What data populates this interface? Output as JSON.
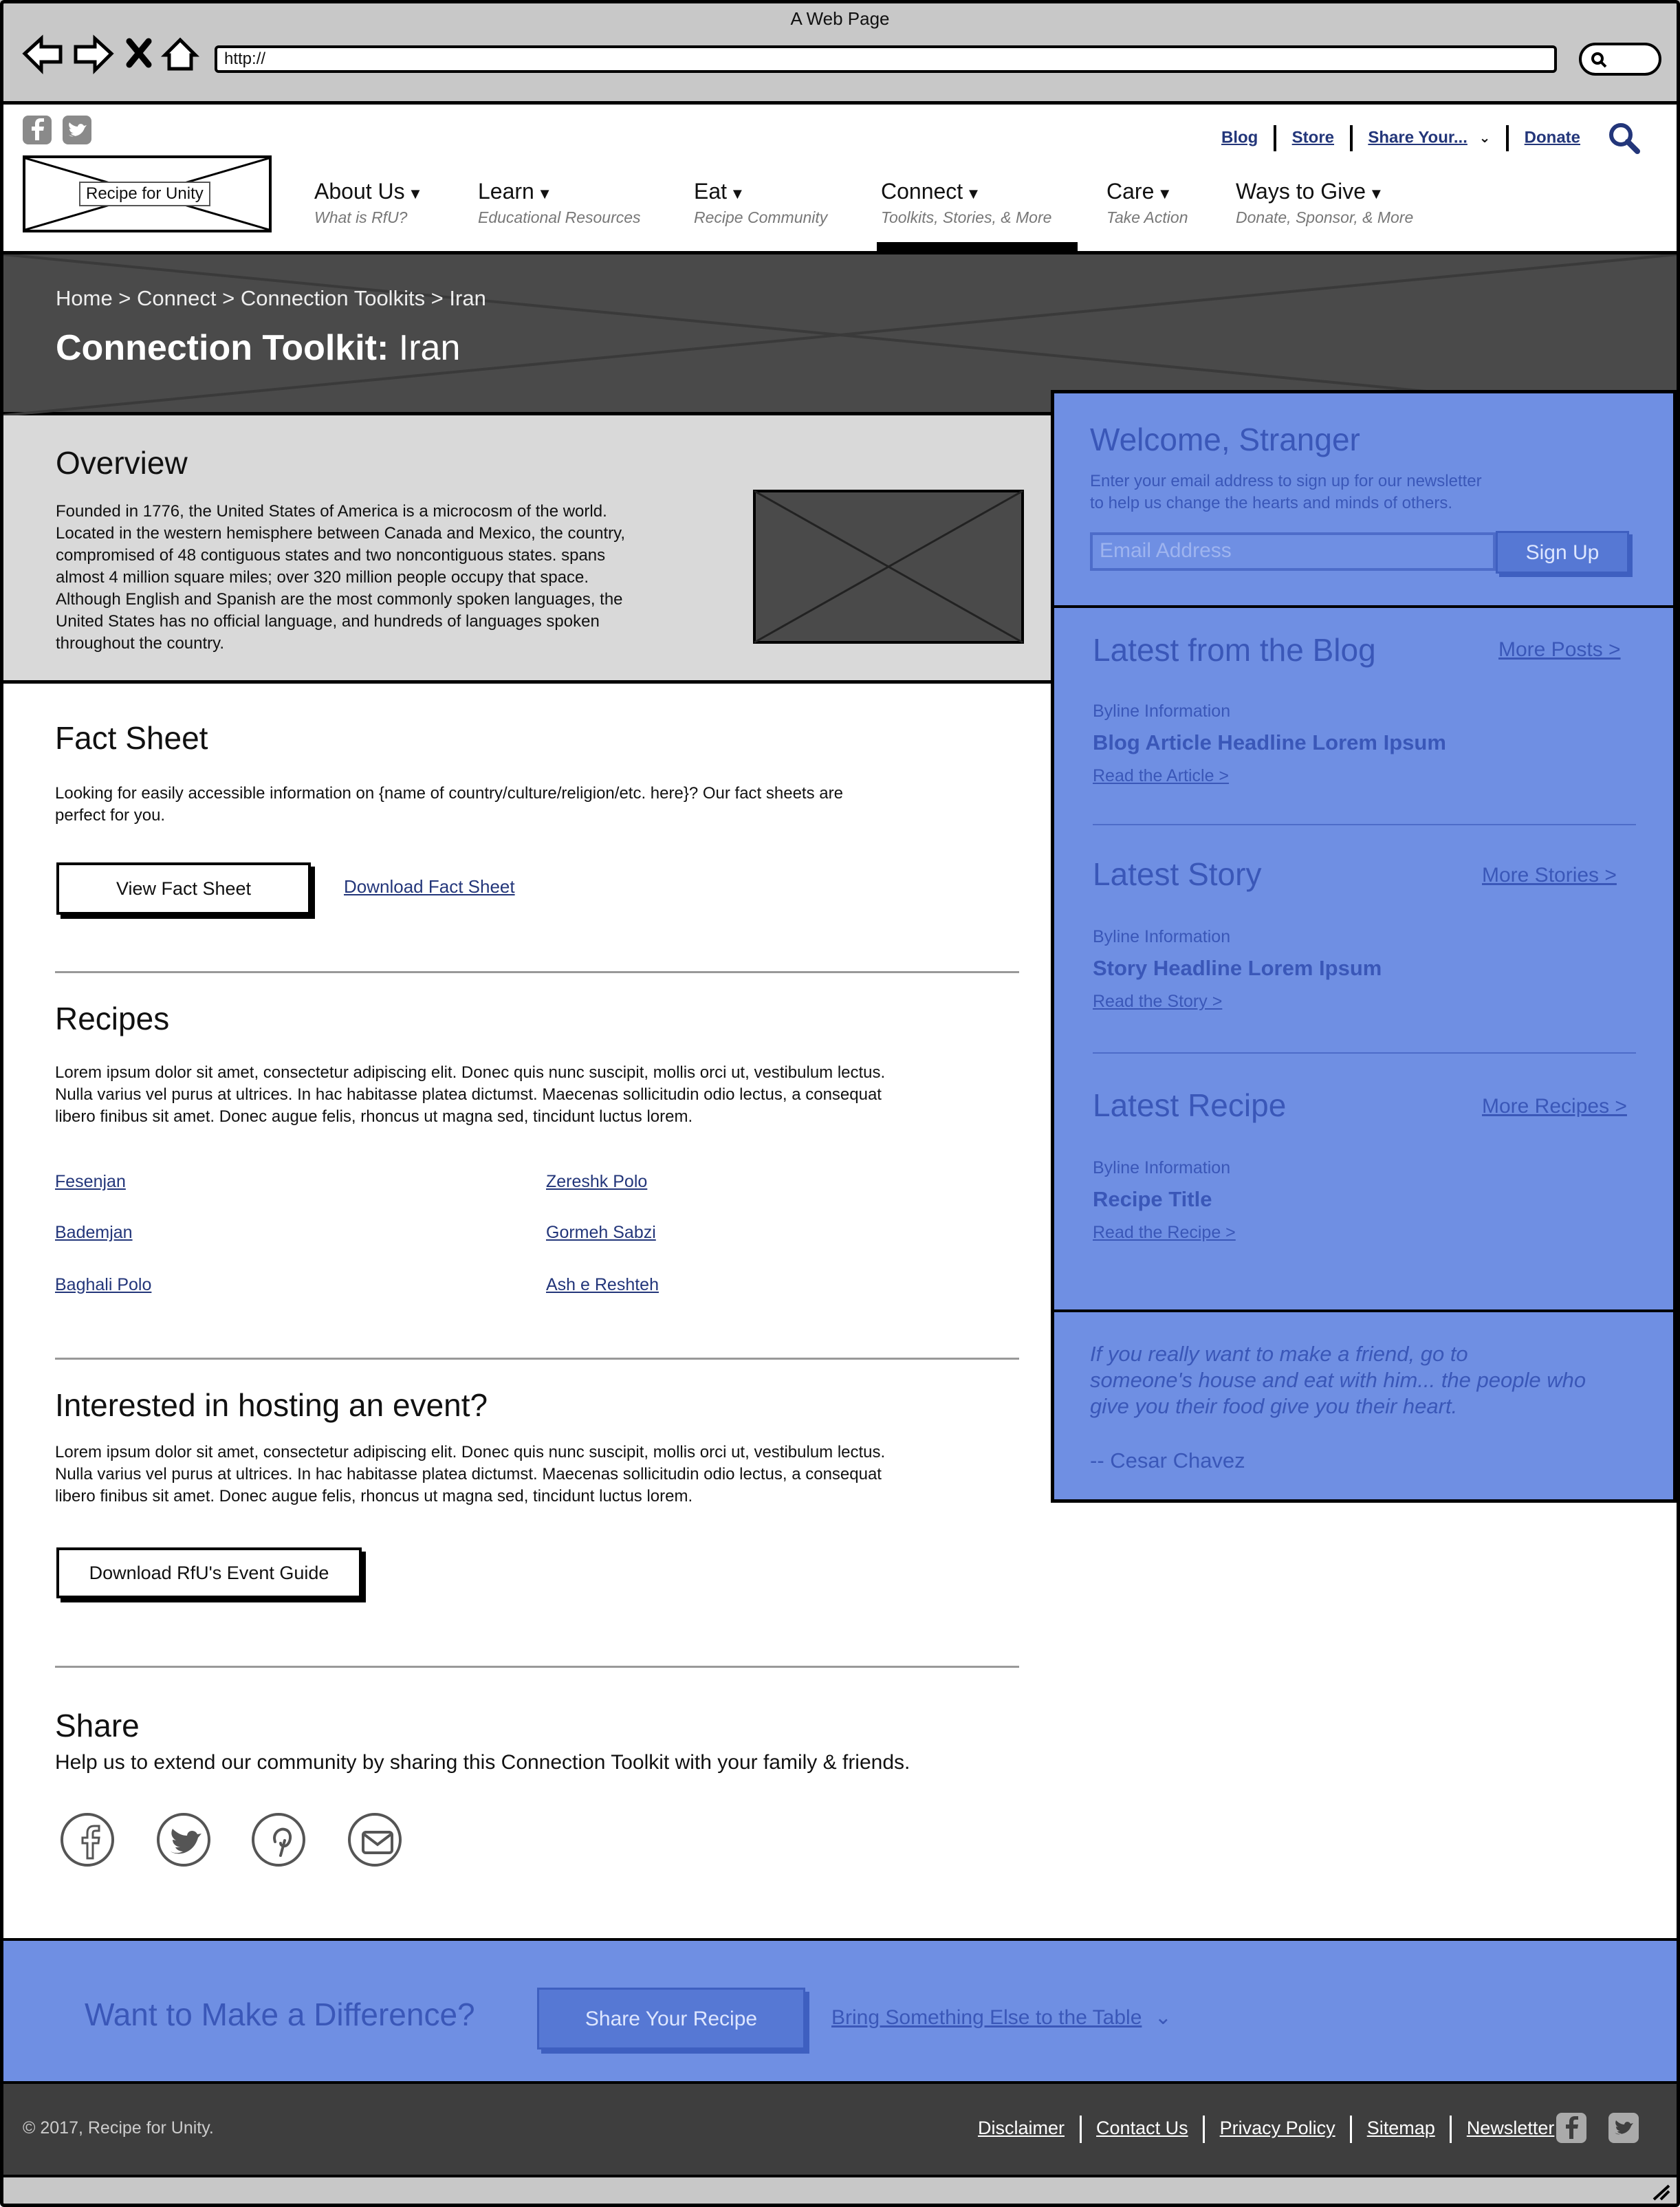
{
  "browser": {
    "title": "A Web Page",
    "url": "http://"
  },
  "header": {
    "logo_text": "Recipe for Unity",
    "utility_links": [
      "Blog",
      "Store",
      "Share Your...",
      "Donate"
    ],
    "nav": [
      {
        "label": "About Us",
        "sub": "What is RfU?"
      },
      {
        "label": "Learn",
        "sub": "Educational Resources"
      },
      {
        "label": "Eat",
        "sub": "Recipe Community"
      },
      {
        "label": "Connect",
        "sub": "Toolkits, Stories, & More"
      },
      {
        "label": "Care",
        "sub": "Take Action"
      },
      {
        "label": "Ways to Give",
        "sub": "Donate, Sponsor, & More"
      }
    ]
  },
  "hero": {
    "breadcrumb": "Home > Connect > Connection Toolkits > Iran",
    "title_bold": "Connection Toolkit:",
    "title_rest": "Iran"
  },
  "overview": {
    "heading": "Overview",
    "lines": [
      "Founded in 1776, the United States of America is a microcosm of the world.",
      "Located in the western hemisphere between Canada and Mexico, the country,",
      "compromised of 48 contiguous states and two noncontiguous states. spans",
      "almost 4 million square miles; over 320 million people occupy that space.",
      "Although English and Spanish are the most commonly spoken languages, the",
      "United States has no official language, and hundreds of languages spoken",
      "throughout the country."
    ]
  },
  "fact_sheet": {
    "heading": "Fact Sheet",
    "lines": [
      "Looking for easily accessible information on {name of country/culture/religion/etc. here}? Our fact sheets are",
      "perfect for you."
    ],
    "view_button": "View Fact Sheet",
    "download_link": "Download Fact Sheet"
  },
  "recipes": {
    "heading": "Recipes",
    "lines": [
      "Lorem ipsum dolor sit amet, consectetur adipiscing elit. Donec quis nunc suscipit, mollis orci ut, vestibulum lectus.",
      "Nulla varius vel purus at ultrices. In hac habitasse platea dictumst. Maecenas sollicitudin odio lectus, a consequat",
      "libero finibus sit amet. Donec augue felis, rhoncus ut magna sed, tincidunt luctus lorem."
    ],
    "links_left": [
      "Fesenjan",
      "Bademjan",
      "Baghali Polo"
    ],
    "links_right": [
      "Zereshk Polo",
      "Gormeh Sabzi",
      "Ash e Reshteh"
    ]
  },
  "event": {
    "heading": "Interested in hosting an event?",
    "lines": [
      "Lorem ipsum dolor sit amet, consectetur adipiscing elit. Donec quis nunc suscipit, mollis orci ut, vestibulum lectus.",
      "Nulla varius vel purus at ultrices. In hac habitasse platea dictumst. Maecenas sollicitudin odio lectus, a consequat",
      "libero finibus sit amet. Donec augue felis, rhoncus ut magna sed, tincidunt luctus lorem."
    ],
    "button": "Download RfU's Event Guide"
  },
  "share": {
    "heading": "Share",
    "text": "Help us to extend our community by sharing this Connection Toolkit with your family & friends.",
    "icons": [
      "facebook-icon",
      "twitter-icon",
      "pinterest-icon",
      "email-icon"
    ]
  },
  "sidebar": {
    "welcome_title": "Welcome, Stranger",
    "welcome_lines": [
      "Enter your email address to sign up for our newsletter",
      "to help us change the hearts and minds of others."
    ],
    "email_placeholder": "Email Address",
    "signup_button": "Sign Up",
    "blog": {
      "title": "Latest from the Blog",
      "more": "More Posts >",
      "byline": "Byline Information",
      "headline": "Blog Article Headline Lorem Ipsum",
      "read": "Read the Article >"
    },
    "story": {
      "title": "Latest Story",
      "more": "More Stories >",
      "byline": "Byline Information",
      "headline": "Story Headline Lorem Ipsum",
      "read": "Read the Story >"
    },
    "recipe": {
      "title": "Latest Recipe",
      "more": "More Recipes >",
      "byline": "Byline Information",
      "headline": "Recipe Title",
      "read": "Read the Recipe >"
    },
    "quote_lines": [
      "If you really want to make a friend, go to",
      "someone's house and eat with him... the people who",
      "give you their food give you their heart."
    ],
    "quote_author": "-- Cesar Chavez"
  },
  "cta": {
    "heading": "Want to Make a Difference?",
    "button": "Share Your Recipe",
    "link": "Bring Something Else to the Table"
  },
  "footer": {
    "copyright": "© 2017, Recipe for Unity.",
    "links": [
      "Disclaimer",
      "Contact Us",
      "Privacy Policy",
      "Sitemap",
      "Newsletter"
    ]
  },
  "colors": {
    "sidebar": "#6f8fe3",
    "hero": "#4a4a4a",
    "footer": "#3e3e3e",
    "link": "#23367a"
  }
}
